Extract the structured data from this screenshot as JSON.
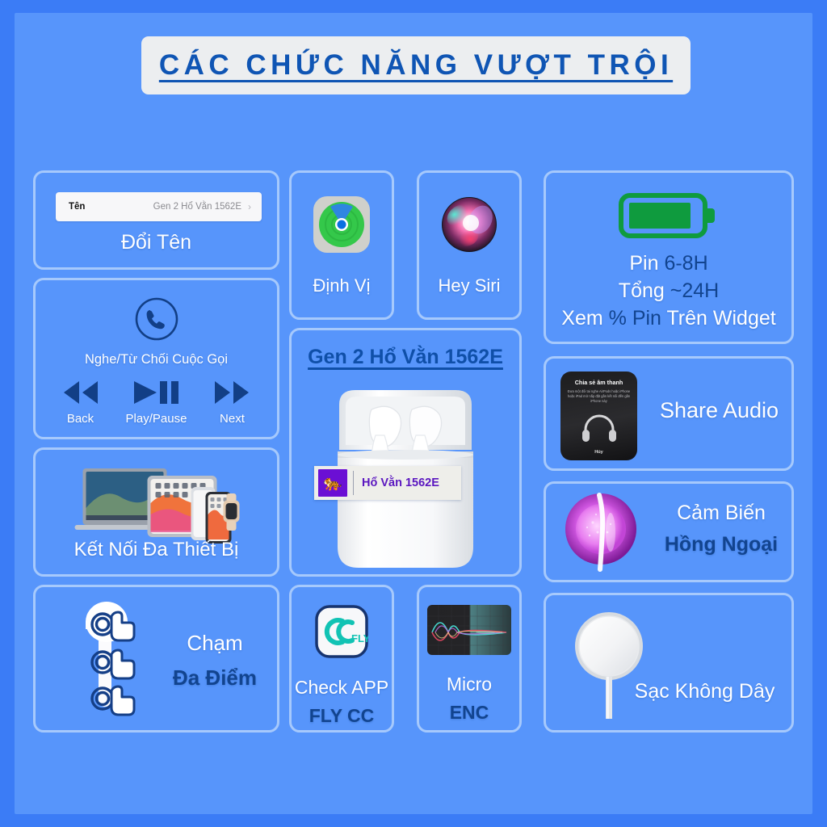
{
  "header": {
    "title": "CÁC CHỨC NĂNG VƯỢT TRỘI"
  },
  "colors": {
    "page_border": "#3b7cf6",
    "background": "#5795fb",
    "card_border": "#a6c9fc",
    "title_text": "#0f55b4",
    "label_white": "#ffffff",
    "label_dark_blue": "#12448f",
    "battery_green": "#12a042",
    "badge_purple": "#6b0fd4"
  },
  "cards": {
    "rename": {
      "row_key": "Tên",
      "row_value": "Gen 2 Hổ Vằn 1562E",
      "row_chevron": "chevron-right-icon",
      "label": "Đổi Tên"
    },
    "calls": {
      "icon": "phone-handset-icon",
      "sub": "Nghe/Từ Chối Cuộc Gọi",
      "buttons": [
        {
          "icon": "rewind-icon",
          "caption": "Back"
        },
        {
          "icon": "play-pause-icon",
          "caption": "Play/Pause"
        },
        {
          "icon": "fast-forward-icon",
          "caption": "Next"
        }
      ]
    },
    "devices": {
      "icon": "apple-devices-icon",
      "label": "Kết Nối Đa Thiết Bị"
    },
    "touch": {
      "icon": "multi-tap-earbud-icon",
      "label_top": "Chạm",
      "label_bottom": "Đa Điểm"
    },
    "find_my": {
      "icon": "find-my-icon",
      "label": "Định Vị"
    },
    "siri": {
      "icon": "siri-orb-icon",
      "label": "Hey Siri"
    },
    "product": {
      "title": "Gen 2 Hổ Vằn 1562E",
      "image": "airpods-case-icon",
      "badge_logo": "tiger-emblem-icon",
      "badge_text": "Hổ Vằn 1562E"
    },
    "check_app": {
      "icon": "fly-cc-app-icon",
      "label_top": "Check APP",
      "label_bottom": "FLY CC"
    },
    "micro": {
      "icon": "enc-waveform-icon",
      "label_top": "Micro",
      "label_bottom": "ENC"
    },
    "battery": {
      "icon": "battery-full-icon",
      "line1_white": "Pin ",
      "line1_dark": "6-8H",
      "line2_white": "Tổng ",
      "line2_dark": "~24H",
      "line3_a": "Xem ",
      "line3_b": "% Pin ",
      "line3_c": "Trên Widget"
    },
    "share_audio": {
      "tile_title": "Chia sẻ âm thanh",
      "tile_body": "Đưa một đôi tai nghe AirPods hoặc iPhone hoặc iPad mở nắp đặt gần kết nối đến gần iPhone này",
      "tile_icon": "headphones-icon",
      "tile_cancel": "Hủy",
      "label": "Share Audio"
    },
    "ir_sensor": {
      "icon": "infrared-sensor-icon",
      "label_top": "Cảm Biến",
      "label_bottom": "Hồng Ngoại"
    },
    "wireless_charging": {
      "icon": "magsafe-charger-icon",
      "label": "Sạc Không Dây"
    }
  }
}
